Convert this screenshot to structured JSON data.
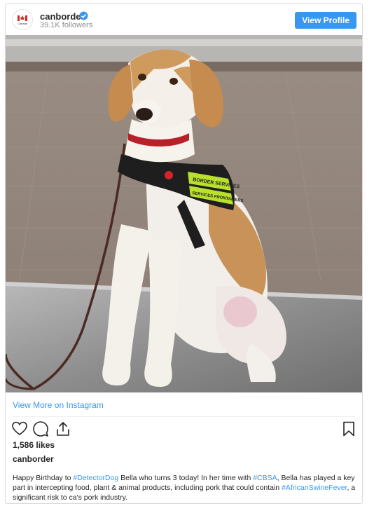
{
  "header": {
    "username": "canborder",
    "followers": "39.1K followers",
    "view_profile_label": "View Profile",
    "avatar_text": "Canada"
  },
  "post": {
    "image_alt": "Detector dog Bella wearing a Border Services harness",
    "harness_text_1": "BORDER SERVICES",
    "harness_text_2": "SERVICES FRONTALIERS",
    "view_more_label": "View More on Instagram",
    "likes": "1,586 likes",
    "owner": "canborder",
    "caption": {
      "p1": "Happy Birthday to ",
      "t1": "#DetectorDog",
      "p2": " Bella who turns 3 today! In her time with ",
      "t2": "#CBSA",
      "p3": ", Bella has played a key part in intercepting food, plant & animal products, including pork that could contain ",
      "t3": "#AfricanSwineFever",
      "p4": ", a significant risk to ca's pork industry."
    }
  },
  "icons": {
    "like": "heart-icon",
    "comment": "comment-icon",
    "share": "share-icon",
    "save": "bookmark-icon",
    "verified": "verified-badge-icon"
  },
  "colors": {
    "link_blue": "#3897f0",
    "text": "#262626",
    "muted": "#8e8e8e"
  }
}
